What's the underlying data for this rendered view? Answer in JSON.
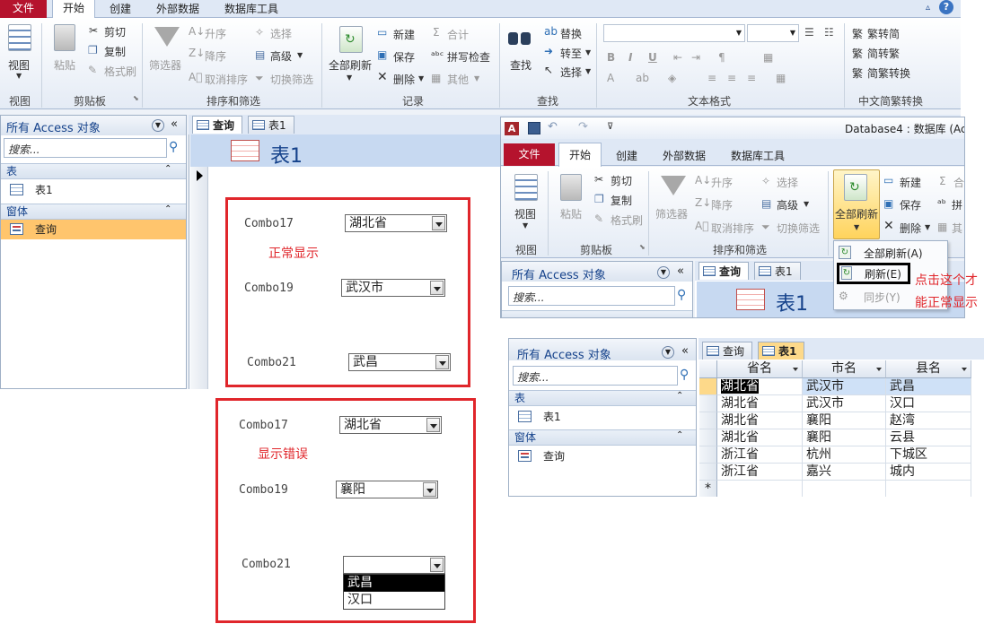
{
  "ribbon_main": {
    "tabs": [
      "文件",
      "开始",
      "创建",
      "外部数据",
      "数据库工具"
    ],
    "view": "视图",
    "paste": "粘贴",
    "cut": "剪切",
    "copy": "复制",
    "format_painter": "格式刷",
    "filter": "筛选器",
    "ascending": "升序",
    "descending": "降序",
    "clear_sort": "取消排序",
    "selection": "选择",
    "advanced": "高级",
    "toggle_filter": "切换筛选",
    "refresh_all": "全部刷新",
    "new": "新建",
    "save": "保存",
    "delete": "删除",
    "totals": "合计",
    "spelling": "拼写检查",
    "more": "其他",
    "find": "查找",
    "replace": "替换",
    "goto": "转至",
    "select": "选择",
    "trad_to_simp": "繁转简",
    "simp_to_trad": "简转繁",
    "simp_trad_convert": "简繁转换",
    "groups": {
      "views": "视图",
      "clipboard": "剪贴板",
      "sort_filter": "排序和筛选",
      "records": "记录",
      "find": "查找",
      "text_format": "文本格式",
      "chinese_convert": "中文简繁转换"
    }
  },
  "nav_main": {
    "title": "所有 Access 对象",
    "search_placeholder": "搜索...",
    "group_tables": "表",
    "table1": "表1",
    "group_forms": "窗体",
    "form_query": "查询"
  },
  "doc_main": {
    "tabs": [
      "查询",
      "表1"
    ],
    "form_title": "表1"
  },
  "panel_normal": {
    "combo17_label": "Combo17",
    "combo17_value": "湖北省",
    "note": "正常显示",
    "combo19_label": "Combo19",
    "combo19_value": "武汉市",
    "combo21_label": "Combo21",
    "combo21_value": "武昌"
  },
  "panel_error": {
    "combo17_label": "Combo17",
    "combo17_value": "湖北省",
    "note": "显示错误",
    "combo19_label": "Combo19",
    "combo19_value": "襄阳",
    "combo21_label": "Combo21",
    "combo21_value": "",
    "dropdown_options": [
      "武昌",
      "汉口"
    ],
    "dropdown_selected": "武昌"
  },
  "inset_window": {
    "title": "Database4 : 数据库 (Acc",
    "tabs": [
      "文件",
      "开始",
      "创建",
      "外部数据",
      "数据库工具"
    ],
    "view": "视图",
    "paste": "粘贴",
    "cut": "剪切",
    "copy": "复制",
    "format_painter": "格式刷",
    "filter": "筛选器",
    "ascending": "升序",
    "descending": "降序",
    "clear_sort": "取消排序",
    "selection": "选择",
    "advanced": "高级",
    "toggle_filter": "切换筛选",
    "refresh_all": "全部刷新",
    "new": "新建",
    "save": "保存",
    "delete": "删除",
    "totals": "合",
    "spelling": "拼",
    "more": "其",
    "groups": {
      "views": "视图",
      "clipboard": "剪贴板",
      "sort_filter": "排序和筛选"
    },
    "menu": {
      "refresh_all": "全部刷新(A)",
      "refresh": "刷新(E)",
      "sync": "同步(Y)"
    },
    "annotation_line1": "点击这个才",
    "annotation_line2": "能正常显示",
    "nav_title": "所有 Access 对象",
    "search_placeholder": "搜索...",
    "doc_tabs": [
      "查询",
      "表1"
    ],
    "form_title": "表1"
  },
  "datasheet": {
    "nav_title": "所有 Access 对象",
    "search_placeholder": "搜索...",
    "group_tables": "表",
    "table1": "表1",
    "group_forms": "窗体",
    "form_query": "查询",
    "doc_tabs": [
      "查询",
      "表1"
    ],
    "columns": [
      "省名",
      "市名",
      "县名"
    ],
    "rows": [
      [
        "湖北省",
        "武汉市",
        "武昌"
      ],
      [
        "湖北省",
        "武汉市",
        "汉口"
      ],
      [
        "湖北省",
        "襄阳",
        "赵湾"
      ],
      [
        "湖北省",
        "襄阳",
        "云县"
      ],
      [
        "浙江省",
        "杭州",
        "下城区"
      ],
      [
        "浙江省",
        "嘉兴",
        "城内"
      ]
    ],
    "new_row_marker": "*"
  },
  "colors": {
    "file_tab": "#b5132d",
    "annotation_red": "#e0262b",
    "ribbon_bg": "#eef2f8",
    "nav_highlight": "#ffc56d"
  }
}
